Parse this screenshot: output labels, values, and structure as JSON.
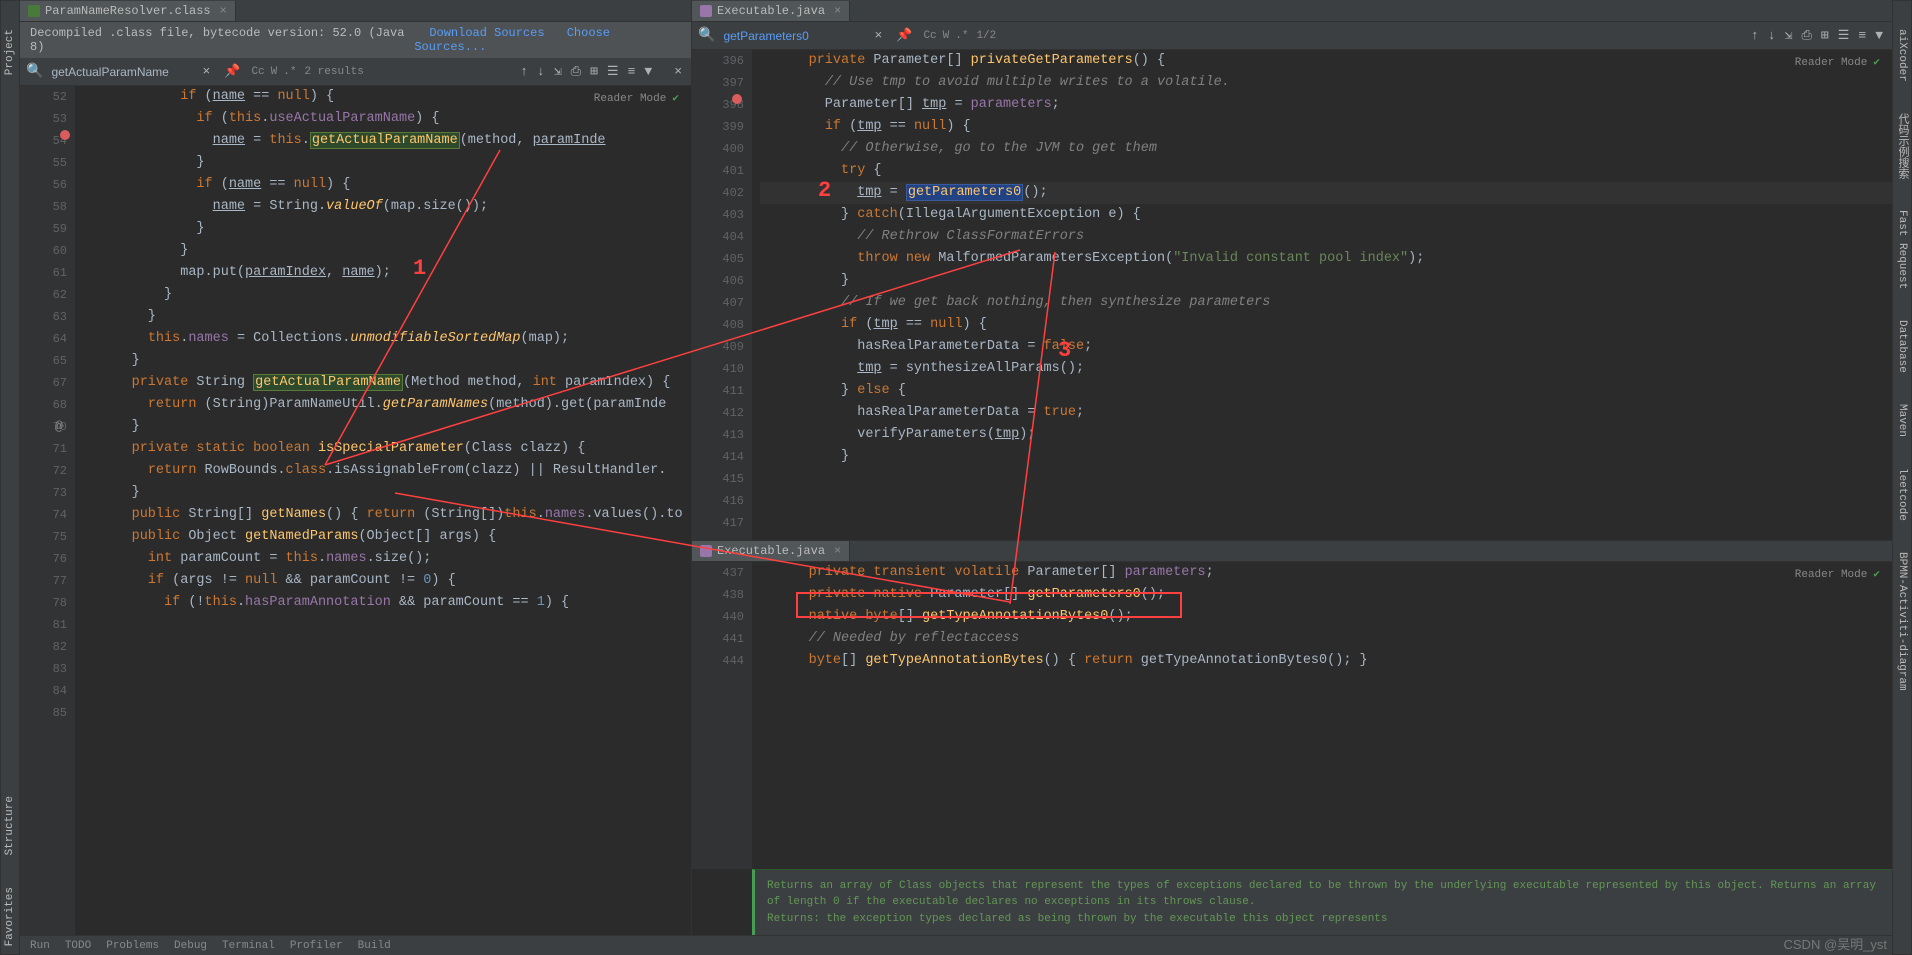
{
  "left_vtabs": [
    "Project",
    "Structure",
    "Favorites"
  ],
  "right_vtabs": [
    "aiXcoder",
    "代码示例搜索",
    "Fast Request",
    "Database",
    "Maven",
    "leetcode",
    "BPMN-Activiti-diagram"
  ],
  "status_items": [
    "Run",
    "TODO",
    "Problems",
    "Debug",
    "Terminal",
    "Profiler",
    "Build"
  ],
  "watermark": "CSDN @吴明_yst",
  "left": {
    "tab": "ParamNameResolver.class",
    "banner_text": "Decompiled .class file, bytecode version: 52.0 (Java 8)",
    "banner_link1": "Download Sources",
    "banner_link2": "Choose Sources...",
    "find_value": "getActualParamName",
    "find_results": "2 results",
    "find_opts": [
      "Cc",
      "W",
      ".*"
    ],
    "reader_label": "Reader Mode",
    "gutter": [
      "52",
      "53",
      "54",
      "55",
      "56",
      "",
      "58",
      "59",
      "60",
      "61",
      "62",
      "63",
      "64",
      "65",
      "",
      "67",
      "68",
      "",
      "70",
      "71",
      "72",
      "73",
      "74",
      "75",
      "76",
      "77",
      "78",
      "",
      "81",
      "82",
      "83",
      "84",
      "85"
    ],
    "bp_line": 2,
    "at_line": 18,
    "code": [
      [
        [
          "",
          ""
        ]
      ],
      [
        [
          "            ",
          ""
        ],
        [
          "if",
          1
        ],
        [
          " (",
          0
        ],
        [
          "name",
          6
        ],
        [
          " == ",
          0
        ],
        [
          "null",
          1
        ],
        [
          ") {",
          0
        ]
      ],
      [
        [
          "              ",
          ""
        ],
        [
          "if",
          1
        ],
        [
          " (",
          0
        ],
        [
          "this",
          1
        ],
        [
          ".",
          0
        ],
        [
          "useActualParamName",
          5
        ],
        [
          ") {",
          0
        ]
      ],
      [
        [
          "                ",
          ""
        ],
        [
          "name",
          6
        ],
        [
          " = ",
          0
        ],
        [
          "this",
          1
        ],
        [
          ".",
          0
        ],
        [
          "getActualParamName",
          8
        ],
        [
          "(method, ",
          0
        ],
        [
          "paramInde",
          6
        ]
      ],
      [
        [
          "              }",
          0
        ]
      ],
      [
        [
          "",
          0
        ]
      ],
      [
        [
          "              ",
          ""
        ],
        [
          "if",
          1
        ],
        [
          " (",
          0
        ],
        [
          "name",
          6
        ],
        [
          " == ",
          0
        ],
        [
          "null",
          1
        ],
        [
          ") {",
          0
        ]
      ],
      [
        [
          "                ",
          ""
        ],
        [
          "name",
          6
        ],
        [
          " = String.",
          0
        ],
        [
          "valueOf",
          7
        ],
        [
          "(map.size());",
          0
        ]
      ],
      [
        [
          "              }",
          0
        ]
      ],
      [
        [
          "            }",
          0
        ]
      ],
      [
        [
          "",
          0
        ]
      ],
      [
        [
          "            map.put(",
          0
        ],
        [
          "paramIndex",
          6
        ],
        [
          ", ",
          0
        ],
        [
          "name",
          6
        ],
        [
          ");",
          0
        ]
      ],
      [
        [
          "          }",
          0
        ]
      ],
      [
        [
          "        }",
          0
        ]
      ],
      [
        [
          "",
          0
        ]
      ],
      [
        [
          "        ",
          ""
        ],
        [
          "this",
          1
        ],
        [
          ".",
          0
        ],
        [
          "names",
          5
        ],
        [
          " = Collections.",
          0
        ],
        [
          "unmodifiableSortedMap",
          7
        ],
        [
          "(map);",
          0
        ]
      ],
      [
        [
          "      }",
          0
        ]
      ],
      [
        [
          "",
          0
        ]
      ],
      [
        [
          "      ",
          ""
        ],
        [
          "private",
          1
        ],
        [
          " String ",
          0
        ],
        [
          "getActualParamName",
          8
        ],
        [
          "(Method method, ",
          0
        ],
        [
          "int",
          1
        ],
        [
          " paramIndex) {",
          0
        ]
      ],
      [
        [
          "        ",
          ""
        ],
        [
          "return",
          1
        ],
        [
          " (String)ParamNameUtil.",
          0
        ],
        [
          "getParamNames",
          7
        ],
        [
          "(method).get(paramInde",
          0
        ]
      ],
      [
        [
          "      }",
          0
        ]
      ],
      [
        [
          "",
          0
        ]
      ],
      [
        [
          "      ",
          ""
        ],
        [
          "private static boolean",
          1
        ],
        [
          " ",
          0
        ],
        [
          "isSpecialParameter",
          3
        ],
        [
          "(Class<?> clazz) {",
          0
        ]
      ],
      [
        [
          "        ",
          ""
        ],
        [
          "return",
          1
        ],
        [
          " RowBounds.",
          0
        ],
        [
          "class",
          1
        ],
        [
          ".isAssignableFrom(clazz) || ResultHandler.",
          0
        ]
      ],
      [
        [
          "      }",
          0
        ]
      ],
      [
        [
          "",
          0
        ]
      ],
      [
        [
          "      ",
          ""
        ],
        [
          "public",
          1
        ],
        [
          " String[] ",
          0
        ],
        [
          "getNames",
          3
        ],
        [
          "() { ",
          0
        ],
        [
          "return",
          1
        ],
        [
          " (String[])",
          0
        ],
        [
          "this",
          1
        ],
        [
          ".",
          0
        ],
        [
          "names",
          5
        ],
        [
          ".values().to",
          0
        ]
      ],
      [
        [
          "",
          0
        ]
      ],
      [
        [
          "      ",
          ""
        ],
        [
          "public",
          1
        ],
        [
          " Object ",
          0
        ],
        [
          "getNamedParams",
          3
        ],
        [
          "(Object[] args) {",
          0
        ]
      ],
      [
        [
          "        ",
          ""
        ],
        [
          "int",
          1
        ],
        [
          " paramCount = ",
          0
        ],
        [
          "this",
          1
        ],
        [
          ".",
          0
        ],
        [
          "names",
          5
        ],
        [
          ".size();",
          0
        ]
      ],
      [
        [
          "        ",
          ""
        ],
        [
          "if",
          1
        ],
        [
          " (args != ",
          0
        ],
        [
          "null",
          1
        ],
        [
          " && paramCount != ",
          0
        ],
        [
          "0",
          4
        ],
        [
          ") {",
          0
        ]
      ],
      [
        [
          "          ",
          ""
        ],
        [
          "if",
          1
        ],
        [
          " (!",
          0
        ],
        [
          "this",
          1
        ],
        [
          ".",
          0
        ],
        [
          "hasParamAnnotation",
          5
        ],
        [
          " && paramCount == ",
          0
        ],
        [
          "1",
          4
        ],
        [
          ") {",
          0
        ]
      ]
    ]
  },
  "right_top": {
    "tab": "Executable.java",
    "find_value": "getParameters0",
    "find_counter": "1/2",
    "find_opts": [
      "Cc",
      "W",
      ".*"
    ],
    "reader_label": "Reader Mode",
    "gutter": [
      "396",
      "397",
      "398",
      "399",
      "400",
      "401",
      "402",
      "403",
      "404",
      "405",
      "406",
      "407",
      "408",
      "409",
      "410",
      "411",
      "412",
      "413",
      "414",
      "415",
      "416",
      "417"
    ],
    "bp_line": 2,
    "hl_line": 8,
    "code": [
      [
        [
          "      ",
          ""
        ],
        [
          "private",
          1
        ],
        [
          " Parameter[] ",
          0
        ],
        [
          "privateGetParameters",
          3
        ],
        [
          "() {",
          0
        ]
      ],
      [
        [
          "        ",
          ""
        ],
        [
          "// Use tmp to avoid multiple writes to a volatile.",
          2
        ]
      ],
      [
        [
          "        Parameter[] ",
          0
        ],
        [
          "tmp",
          6
        ],
        [
          " = ",
          0
        ],
        [
          "parameters",
          5
        ],
        [
          ";",
          0
        ]
      ],
      [
        [
          "",
          0
        ]
      ],
      [
        [
          "        ",
          ""
        ],
        [
          "if",
          1
        ],
        [
          " (",
          0
        ],
        [
          "tmp",
          6
        ],
        [
          " == ",
          0
        ],
        [
          "null",
          1
        ],
        [
          ") {",
          0
        ]
      ],
      [
        [
          "",
          0
        ]
      ],
      [
        [
          "          ",
          ""
        ],
        [
          "// Otherwise, go to the JVM to get them",
          2
        ]
      ],
      [
        [
          "          ",
          ""
        ],
        [
          "try",
          1
        ],
        [
          " {",
          0
        ]
      ],
      [
        [
          "            ",
          ""
        ],
        [
          "tmp",
          6
        ],
        [
          " = ",
          0
        ],
        [
          "getParameters0",
          9
        ],
        [
          "();",
          0
        ]
      ],
      [
        [
          "          } ",
          0
        ],
        [
          "catch",
          1
        ],
        [
          "(IllegalArgumentException e) {",
          0
        ]
      ],
      [
        [
          "            ",
          ""
        ],
        [
          "// Rethrow ClassFormatErrors",
          2
        ]
      ],
      [
        [
          "            ",
          ""
        ],
        [
          "throw new",
          1
        ],
        [
          " MalformedParametersException(",
          0
        ],
        [
          "\"Invalid constant pool index\"",
          10
        ],
        [
          ");",
          0
        ]
      ],
      [
        [
          "          }",
          0
        ]
      ],
      [
        [
          "",
          0
        ]
      ],
      [
        [
          "          ",
          ""
        ],
        [
          "// If we get back nothing, then synthesize parameters",
          2
        ]
      ],
      [
        [
          "          ",
          ""
        ],
        [
          "if",
          1
        ],
        [
          " (",
          0
        ],
        [
          "tmp",
          6
        ],
        [
          " == ",
          0
        ],
        [
          "null",
          1
        ],
        [
          ") {",
          0
        ]
      ],
      [
        [
          "            hasRealParameterData = ",
          0
        ],
        [
          "false",
          1
        ],
        [
          ";",
          0
        ]
      ],
      [
        [
          "            ",
          ""
        ],
        [
          "tmp",
          6
        ],
        [
          " = synthesizeAllParams();",
          0
        ]
      ],
      [
        [
          "          } ",
          0
        ],
        [
          "else",
          1
        ],
        [
          " {",
          0
        ]
      ],
      [
        [
          "            hasRealParameterData = ",
          0
        ],
        [
          "true",
          1
        ],
        [
          ";",
          0
        ]
      ],
      [
        [
          "            verifyParameters(",
          0
        ],
        [
          "tmp",
          6
        ],
        [
          ");",
          0
        ]
      ],
      [
        [
          "          }",
          0
        ]
      ]
    ]
  },
  "right_bot": {
    "tab": "Executable.java",
    "reader_label": "Reader Mode",
    "gutter": [
      "",
      "437",
      "438",
      "",
      "440",
      "441",
      "",
      "444"
    ],
    "code": [
      [
        [
          "      ",
          ""
        ],
        [
          "private transient volatile",
          1
        ],
        [
          " Parameter[] ",
          0
        ],
        [
          "parameters",
          5
        ],
        [
          ";",
          0
        ]
      ],
      [
        [
          "",
          0
        ]
      ],
      [
        [
          "      ",
          ""
        ],
        [
          "private native",
          1
        ],
        [
          " Parameter[] ",
          0
        ],
        [
          "getParameters0",
          3
        ],
        [
          "();",
          0
        ]
      ],
      [
        [
          "      ",
          ""
        ],
        [
          "native byte",
          1
        ],
        [
          "[] ",
          0
        ],
        [
          "getTypeAnnotationBytes0",
          3
        ],
        [
          "();",
          0
        ]
      ],
      [
        [
          "",
          0
        ]
      ],
      [
        [
          "      ",
          ""
        ],
        [
          "// Needed by reflectaccess",
          2
        ]
      ],
      [
        [
          "      ",
          ""
        ],
        [
          "byte",
          1
        ],
        [
          "[] ",
          0
        ],
        [
          "getTypeAnnotationBytes",
          3
        ],
        [
          "() { ",
          0
        ],
        [
          "return",
          1
        ],
        [
          " getTypeAnnotationBytes0(); }",
          0
        ]
      ],
      [
        [
          "",
          0
        ]
      ]
    ],
    "doc1": "Returns an array of Class objects that represent the types of exceptions declared to be thrown by the underlying executable represented by this object. Returns an array of length 0 if the executable declares no exceptions in its throws clause.",
    "doc2": "Returns: the exception types declared as being thrown by the executable this object represents"
  },
  "annotations": {
    "a1": "1",
    "a2": "2",
    "a3": "3"
  }
}
